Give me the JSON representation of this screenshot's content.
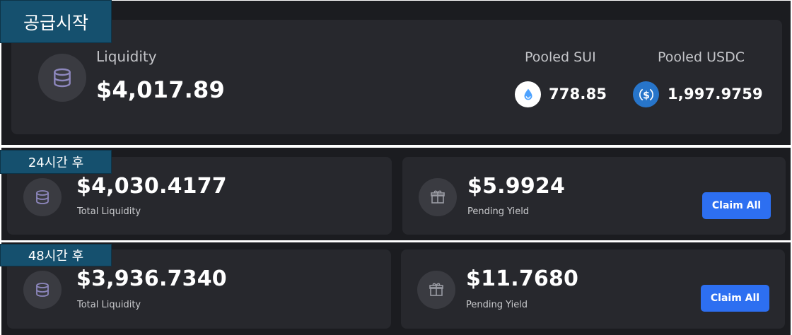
{
  "steps": {
    "start": "공급시작",
    "after24": "24시간 후",
    "after48": "48시간 후"
  },
  "liquidity_overview": {
    "label": "Liquidity",
    "value": "$4,017.89",
    "pooled_sui_label": "Pooled SUI",
    "pooled_sui_value": "778.85",
    "pooled_usdc_label": "Pooled USDC",
    "pooled_usdc_value": "1,997.9759",
    "icons": [
      "database-icon",
      "sui-icon",
      "usdc-icon"
    ]
  },
  "after24": {
    "total_liquidity_value": "$4,030.4177",
    "total_liquidity_label": "Total Liquidity",
    "pending_yield_value": "$5.9924",
    "pending_yield_label": "Pending Yield",
    "claim_label": "Claim All"
  },
  "after48": {
    "total_liquidity_value": "$3,936.7340",
    "total_liquidity_label": "Total Liquidity",
    "pending_yield_value": "$11.7680",
    "pending_yield_label": "Pending Yield",
    "claim_label": "Claim All"
  },
  "colors": {
    "panel_bg": "#1b1c20",
    "card_bg": "#27282d",
    "label_bg": "#15506e",
    "button": "#2d6ff1",
    "usdc": "#2775ca"
  }
}
